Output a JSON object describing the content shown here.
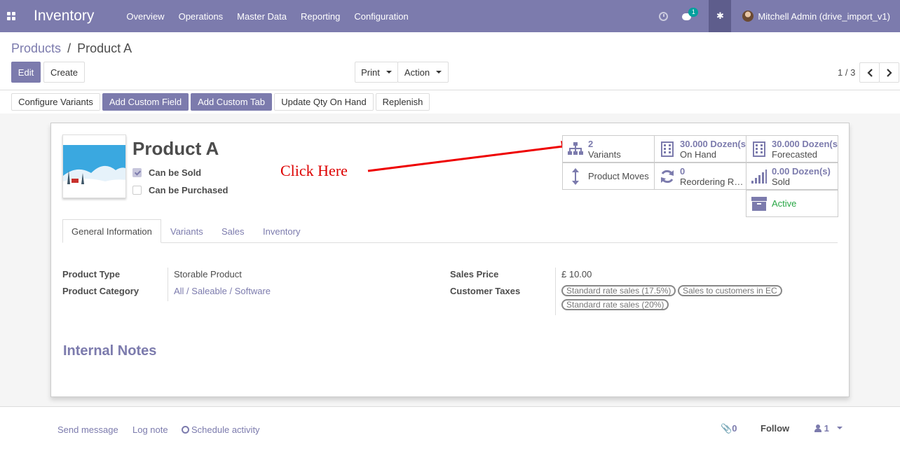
{
  "navbar": {
    "app_title": "Inventory",
    "menu": [
      "Overview",
      "Operations",
      "Master Data",
      "Reporting",
      "Configuration"
    ],
    "messages_count": "1",
    "user": "Mitchell Admin (drive_import_v1)",
    "color": "#7c7bad"
  },
  "breadcrumb": {
    "parent": "Products",
    "separator": "/",
    "current": "Product A"
  },
  "controls": {
    "edit": "Edit",
    "create": "Create",
    "print": "Print",
    "action": "Action",
    "pager": "1 / 3"
  },
  "header_buttons": [
    "Configure Variants",
    "Add Custom Field",
    "Add Custom Tab",
    "Update Qty On Hand",
    "Replenish"
  ],
  "product": {
    "name": "Product A",
    "can_be_sold_label": "Can be Sold",
    "can_be_sold": true,
    "can_be_purchased_label": "Can be Purchased",
    "can_be_purchased": false
  },
  "annotation": "Click Here",
  "smart_buttons": {
    "variants": {
      "value": "2",
      "label": "Variants"
    },
    "on_hand": {
      "value": "30.000",
      "unit": "Dozen(s)",
      "label": "On Hand"
    },
    "forecasted": {
      "value": "30.000",
      "unit": "Dozen(s)",
      "label": "Forecasted"
    },
    "product_moves": {
      "label": "Product Moves"
    },
    "reordering": {
      "value": "0",
      "label": "Reordering Rules"
    },
    "sold": {
      "value": "0.00",
      "unit": "Dozen(s)",
      "label": "Sold"
    },
    "active": {
      "label": "Active"
    }
  },
  "tabs": [
    "General Information",
    "Variants",
    "Sales",
    "Inventory"
  ],
  "fields": {
    "product_type_label": "Product Type",
    "product_type": "Storable Product",
    "product_category_label": "Product Category",
    "product_category": "All / Saleable / Software",
    "sales_price_label": "Sales Price",
    "sales_price": "£ 10.00",
    "customer_taxes_label": "Customer Taxes",
    "customer_taxes": [
      "Standard rate sales (17.5%)",
      "Sales to customers in EC",
      "Standard rate sales (20%)"
    ]
  },
  "internal_notes": "Internal Notes",
  "chatter": {
    "send_message": "Send message",
    "log_note": "Log note",
    "schedule_activity": "Schedule activity",
    "attachments": "0",
    "follow": "Follow",
    "followers": "1"
  }
}
